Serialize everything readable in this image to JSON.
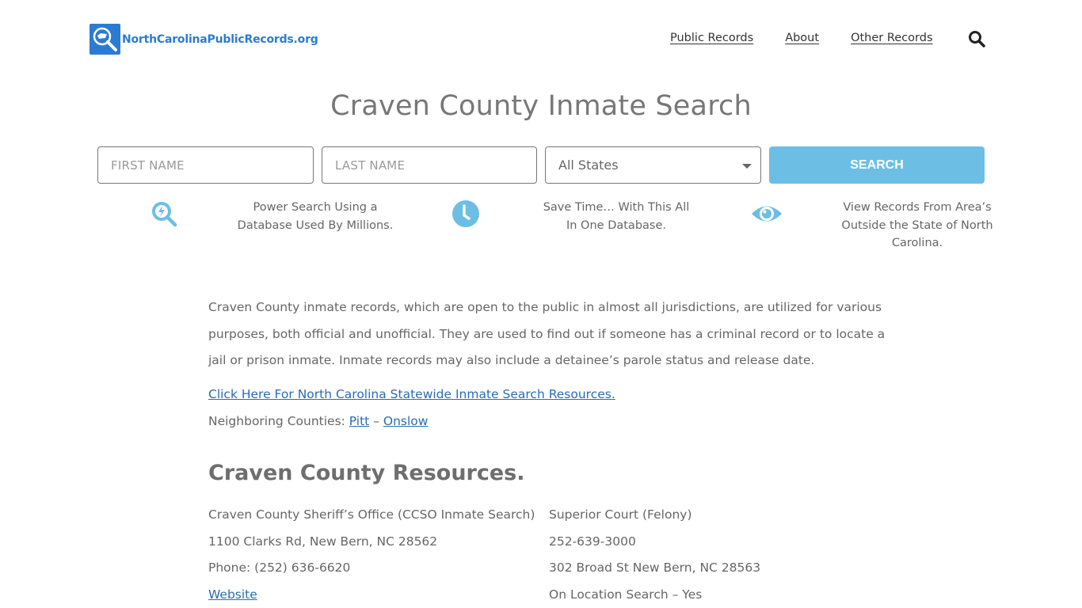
{
  "site": {
    "logo_text": "NorthCarolinaPublicRecords.org",
    "brand_color": "#2b7bd3",
    "accent_color": "#6cbee5"
  },
  "nav": {
    "items": [
      {
        "label": "Public Records"
      },
      {
        "label": "About"
      },
      {
        "label": "Other Records"
      }
    ],
    "search_icon": "search-icon"
  },
  "page_title": "Craven County Inmate Search",
  "search_form": {
    "first_name_placeholder": "FIRST NAME",
    "first_name_value": "",
    "last_name_placeholder": "LAST NAME",
    "last_name_value": "",
    "state_selected": "All States",
    "search_label": "SEARCH"
  },
  "features": [
    {
      "icon": "power-search-icon",
      "text": "Power Search Using a Database Used By Millions."
    },
    {
      "icon": "clock-icon",
      "text": "Save Time… With This All In One Database."
    },
    {
      "icon": "eye-icon",
      "text": "View Records From Area’s Outside the State of North Carolina."
    }
  ],
  "intro": "Craven County inmate records, which are open to the public in almost all jurisdictions, are utilized for various purposes, both official and unofficial. They are used to find out if someone has a criminal record or to locate a jail or prison inmate. Inmate records may also include a detainee’s parole status and release date.",
  "statewide_link": "Click Here For North Carolina Statewide Inmate Search Resources.",
  "neighbors": {
    "label": "Neighboring Counties: ",
    "separator": " – ",
    "counties": [
      "Pitt",
      "Onslow"
    ]
  },
  "resources": {
    "title": "Craven County Resources.",
    "sheriff": {
      "name": "Craven County Sheriff’s Office (CCSO Inmate Search)",
      "address": "1100 Clarks Rd, New Bern, NC 28562",
      "phone": "Phone: (252) 636-6620",
      "website_label": "Website"
    },
    "court": {
      "name": "Superior Court (Felony)",
      "phone": "252-639-3000",
      "address": "302 Broad St New Bern, NC 28563",
      "on_location": "On Location Search – Yes"
    }
  }
}
